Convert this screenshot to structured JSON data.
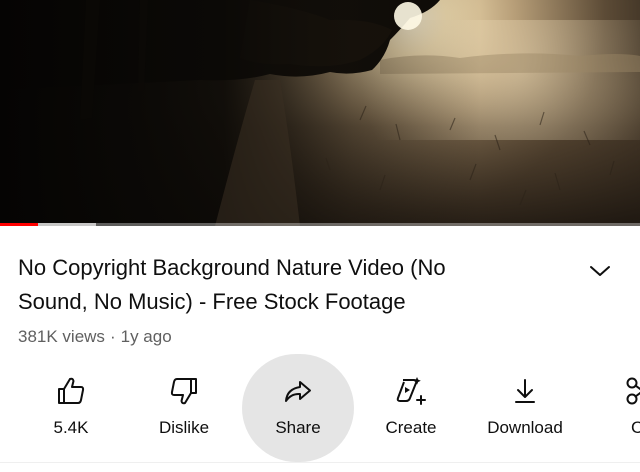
{
  "video": {
    "title": "No Copyright Background Nature Video (No Sound, No Music) - Free Stock Footage",
    "title_line1": "No Copyright Background Nature Video (No",
    "title_line2": "Sound, No Music) - Free Stock Footage",
    "views": "381K views",
    "separator": "·",
    "age": "1y ago",
    "progress_fraction": 0.06,
    "buffered_fraction": 0.15
  },
  "actions": {
    "like_count": "5.4K",
    "dislike_label": "Dislike",
    "share_label": "Share",
    "create_label": "Create",
    "download_label": "Download",
    "clip_label_partial": "Cl"
  },
  "colors": {
    "progress": "#ff0000",
    "text_primary": "#0f0f0f",
    "text_secondary": "#606060",
    "share_highlight": "#e5e5e5"
  },
  "icons": {
    "like": "thumbs-up-icon",
    "dislike": "thumbs-down-icon",
    "share": "share-arrow-icon",
    "create": "create-sparkle-icon",
    "download": "download-icon",
    "clip": "scissors-icon",
    "expand": "chevron-down-icon"
  }
}
